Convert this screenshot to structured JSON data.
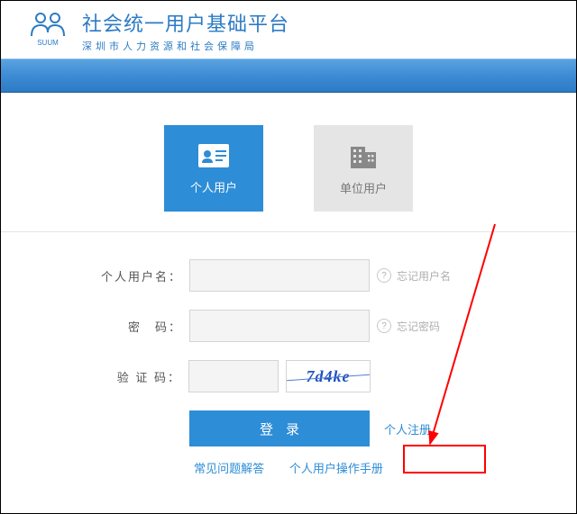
{
  "header": {
    "title": "社会统一用户基础平台",
    "subtitle": "深圳市人力资源和社会保障局",
    "logo_sub": "SUUM"
  },
  "tabs": {
    "personal": "个人用户",
    "org": "单位用户"
  },
  "form": {
    "username_label": "个人用户名：",
    "password_label": "密　码：",
    "captcha_label": "验 证 码：",
    "forgot_user": "忘记用户名",
    "forgot_pass": "忘记密码",
    "captcha_text": "7d4ke",
    "login_btn": "登录",
    "register_link": "个人注册"
  },
  "footer": {
    "faq": "常见问题解答",
    "manual": "个人用户操作手册"
  }
}
